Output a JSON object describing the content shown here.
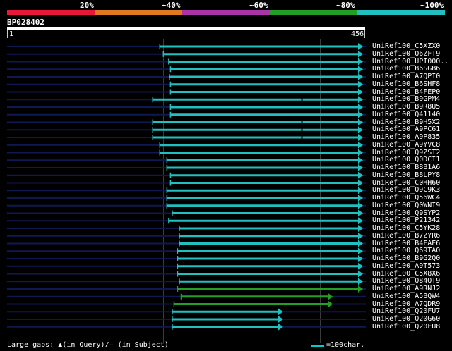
{
  "identity_scale": {
    "labels": [
      "20%",
      "~40%",
      "~60%",
      "~80%",
      "~100%"
    ],
    "colors": [
      "#e8183a",
      "#e07a1e",
      "#a834a8",
      "#23a023",
      "#20c0c0"
    ]
  },
  "query": {
    "id": "BP028402",
    "start": "1",
    "end": "456",
    "length": 456
  },
  "hits": [
    {
      "name": "UniRef100_C5XZX0",
      "start": 0.43,
      "end": 1.0,
      "color": "cyan"
    },
    {
      "name": "UniRef100_Q6ZFT9",
      "start": 0.44,
      "end": 1.0,
      "color": "cyan"
    },
    {
      "name": "UniRef100_UPI000..",
      "start": 0.455,
      "end": 1.0,
      "color": "cyan"
    },
    {
      "name": "UniRef100_B6SGB6",
      "start": 0.46,
      "end": 1.0,
      "color": "cyan"
    },
    {
      "name": "UniRef100_A7QPI0",
      "start": 0.457,
      "end": 1.0,
      "color": "cyan"
    },
    {
      "name": "UniRef100_B6SHF8",
      "start": 0.46,
      "end": 1.0,
      "color": "cyan"
    },
    {
      "name": "UniRef100_B4FEP0",
      "start": 0.46,
      "end": 1.0,
      "color": "cyan"
    },
    {
      "name": "UniRef100_B9GPM4",
      "start": 0.41,
      "end": 1.0,
      "color": "cyan",
      "gap": 0.83
    },
    {
      "name": "UniRef100_B9R8U5",
      "start": 0.46,
      "end": 1.0,
      "color": "cyan"
    },
    {
      "name": "UniRef100_Q41140",
      "start": 0.46,
      "end": 1.0,
      "color": "cyan"
    },
    {
      "name": "UniRef100_B9H5X2",
      "start": 0.41,
      "end": 1.0,
      "color": "cyan",
      "gap": 0.83
    },
    {
      "name": "UniRef100_A9PC61",
      "start": 0.41,
      "end": 1.0,
      "color": "cyan",
      "gap": 0.83
    },
    {
      "name": "UniRef100_A9P835",
      "start": 0.41,
      "end": 1.0,
      "color": "cyan",
      "gap": 0.83
    },
    {
      "name": "UniRef100_A9YVC8",
      "start": 0.43,
      "end": 1.0,
      "color": "cyan"
    },
    {
      "name": "UniRef100_Q9ZST2",
      "start": 0.43,
      "end": 1.0,
      "color": "cyan"
    },
    {
      "name": "UniRef100_Q0DCI1",
      "start": 0.45,
      "end": 1.0,
      "color": "cyan"
    },
    {
      "name": "UniRef100_B8B1A6",
      "start": 0.45,
      "end": 1.0,
      "color": "cyan"
    },
    {
      "name": "UniRef100_B8LPY8",
      "start": 0.46,
      "end": 1.0,
      "color": "cyan"
    },
    {
      "name": "UniRef100_C0HH60",
      "start": 0.46,
      "end": 1.0,
      "color": "cyan"
    },
    {
      "name": "UniRef100_Q9C9K3",
      "start": 0.45,
      "end": 1.0,
      "color": "cyan"
    },
    {
      "name": "UniRef100_Q56WC4",
      "start": 0.45,
      "end": 1.0,
      "color": "cyan"
    },
    {
      "name": "UniRef100_Q0WNI9",
      "start": 0.45,
      "end": 1.0,
      "color": "cyan"
    },
    {
      "name": "UniRef100_Q9SYP2",
      "start": 0.465,
      "end": 1.0,
      "color": "cyan"
    },
    {
      "name": "UniRef100_P21342",
      "start": 0.455,
      "end": 1.0,
      "color": "cyan"
    },
    {
      "name": "UniRef100_C5YK28",
      "start": 0.485,
      "end": 1.0,
      "color": "cyan"
    },
    {
      "name": "UniRef100_B7ZYR6",
      "start": 0.485,
      "end": 1.0,
      "color": "cyan"
    },
    {
      "name": "UniRef100_B4FAE6",
      "start": 0.485,
      "end": 1.0,
      "color": "cyan"
    },
    {
      "name": "UniRef100_Q69TA0",
      "start": 0.48,
      "end": 1.0,
      "color": "cyan"
    },
    {
      "name": "UniRef100_B9G2Q0",
      "start": 0.48,
      "end": 1.0,
      "color": "cyan"
    },
    {
      "name": "UniRef100_A9T573",
      "start": 0.48,
      "end": 1.0,
      "color": "cyan"
    },
    {
      "name": "UniRef100_C5X8X6",
      "start": 0.48,
      "end": 1.0,
      "color": "cyan"
    },
    {
      "name": "UniRef100_Q84QT9",
      "start": 0.485,
      "end": 1.0,
      "color": "cyan"
    },
    {
      "name": "UniRef100_A9RNJ2",
      "start": 0.48,
      "end": 1.0,
      "color": "green"
    },
    {
      "name": "UniRef100_A5BQW4",
      "start": 0.49,
      "end": 0.915,
      "color": "green"
    },
    {
      "name": "UniRef100_A7QDR9",
      "start": 0.47,
      "end": 0.915,
      "color": "green"
    },
    {
      "name": "UniRef100_Q20FU7",
      "start": 0.465,
      "end": 0.775,
      "color": "cyan"
    },
    {
      "name": "UniRef100_Q20G60",
      "start": 0.465,
      "end": 0.775,
      "color": "cyan"
    },
    {
      "name": "UniRef100_Q20FU8",
      "start": 0.465,
      "end": 0.775,
      "color": "cyan"
    }
  ],
  "footer": {
    "gaps_label": "Large gaps:",
    "in_query": "(in Query)/",
    "in_subject": "(in Subject)",
    "legend": "=100char."
  }
}
